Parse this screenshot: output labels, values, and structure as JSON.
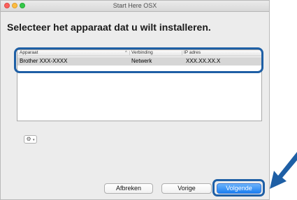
{
  "window": {
    "title": "Start Here OSX"
  },
  "heading": "Selecteer het apparaat dat u wilt installeren.",
  "table": {
    "columns": [
      "Apparaat",
      "Verbinding",
      "IP adres"
    ],
    "rows": [
      {
        "device": "Brother  XXX-XXXX",
        "connection": "Netwerk",
        "ip": "XXX.XX.XX.X"
      }
    ]
  },
  "gear_button": {
    "icon": "gear-icon",
    "caret": "▾"
  },
  "buttons": {
    "cancel": "Afbreken",
    "previous": "Vorige",
    "next": "Volgende"
  },
  "colors": {
    "highlight": "#1e5fa5",
    "primary_button": "#1b7ff2",
    "selected_row": "#d6d6d6"
  }
}
